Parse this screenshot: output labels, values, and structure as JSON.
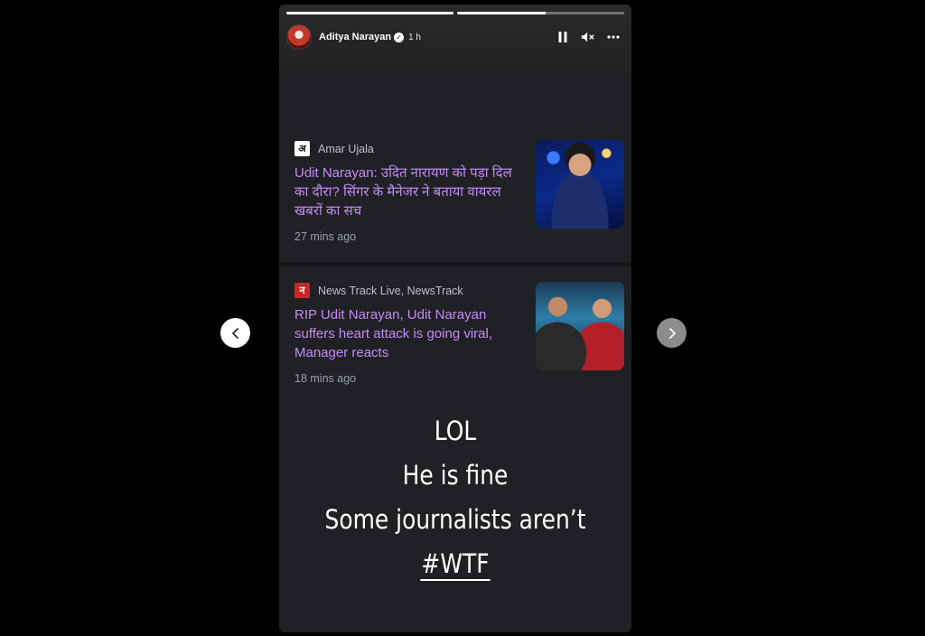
{
  "story": {
    "progress": [
      1.0,
      0.53
    ],
    "header": {
      "username": "Aditya Narayan",
      "time_ago": "1 h",
      "icons": {
        "avatar": "profile-avatar",
        "verified": "verified-badge-icon",
        "pause": "pause-icon",
        "mute": "muted-speaker-icon",
        "more": "more-options-icon"
      }
    },
    "articles": [
      {
        "source": "Amar Ujala",
        "source_logo": "अ",
        "headline": "Udit Narayan: उदित नारायण को पड़ा दिल का दौरा? सिंगर के मैनेजर ने बताया वायरल खबरों का सच",
        "time_ago": "27 mins ago"
      },
      {
        "source": "News Track Live, NewsTrack",
        "source_logo": "न",
        "headline": "RIP Udit Narayan, Udit Narayan suffers heart attack is going viral, Manager reacts",
        "time_ago": "18 mins ago"
      }
    ],
    "caption": {
      "line1": "LOL",
      "line2": "He is fine",
      "line3": "Some journalists aren’t",
      "line4": "#WTF"
    }
  },
  "colors": {
    "headline": "#c58af9",
    "card_background": "#202124",
    "page_background": "#000000"
  }
}
